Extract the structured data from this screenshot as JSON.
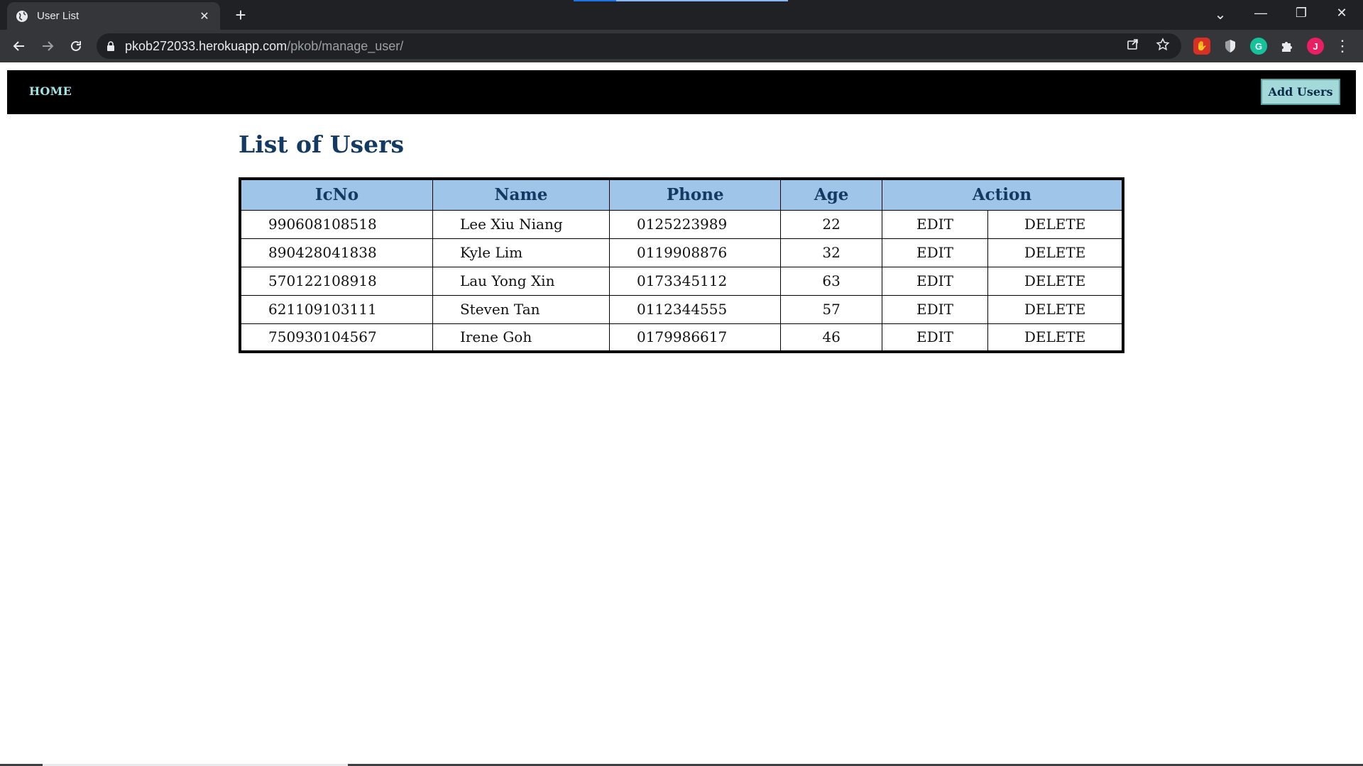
{
  "browser": {
    "tab_title": "User List",
    "tab_close": "✕",
    "new_tab": "+",
    "url_host": "pkob272033.herokuapp.com",
    "url_path": "/pkob/manage_user/",
    "profile_initial": "J",
    "grammarly_letter": "G",
    "window_controls": {
      "minimize": "—",
      "restore": "❐",
      "close": "✕",
      "tab_search": "⌄"
    }
  },
  "nav": {
    "home_label": "HOME",
    "add_users_label": "Add Users"
  },
  "page": {
    "title": "List of Users"
  },
  "table": {
    "headers": [
      "IcNo",
      "Name",
      "Phone",
      "Age",
      "Action"
    ],
    "rows": [
      {
        "icno": "990608108518",
        "name": "Lee Xiu Niang",
        "phone": "0125223989",
        "age": "22",
        "edit": "EDIT",
        "delete": "DELETE"
      },
      {
        "icno": "890428041838",
        "name": "Kyle Lim",
        "phone": "0119908876",
        "age": "32",
        "edit": "EDIT",
        "delete": "DELETE"
      },
      {
        "icno": "570122108918",
        "name": "Lau Yong Xin",
        "phone": "0173345112",
        "age": "63",
        "edit": "EDIT",
        "delete": "DELETE"
      },
      {
        "icno": "621109103111",
        "name": "Steven Tan",
        "phone": "0112344555",
        "age": "57",
        "edit": "EDIT",
        "delete": "DELETE"
      },
      {
        "icno": "750930104567",
        "name": "Irene Goh",
        "phone": "0179986617",
        "age": "46",
        "edit": "EDIT",
        "delete": "DELETE"
      }
    ]
  },
  "colors": {
    "nav_bg": "#000000",
    "home_link": "#a3e4e4",
    "add_users_bg": "#a3d9d9",
    "title": "#123a63",
    "header_bg": "#9fc5e8",
    "edit": "#4a7fc1",
    "delete": "#e0000c"
  }
}
